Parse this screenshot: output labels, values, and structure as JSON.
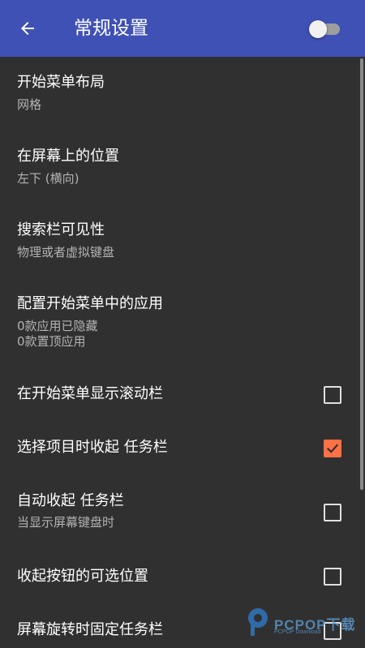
{
  "toolbar": {
    "title": "常规设置",
    "back_icon": "arrow-back-icon",
    "toggle_on": false,
    "background_color": "#3f51b5"
  },
  "settings": [
    {
      "title": "开始菜单布局",
      "subtitle": "网格"
    },
    {
      "title": "在屏幕上的位置",
      "subtitle": "左下 (横向)"
    },
    {
      "title": "搜索栏可见性",
      "subtitle": "物理或者虚拟键盘"
    },
    {
      "title": "配置开始菜单中的应用",
      "subtitle": "0款应用已隐藏",
      "subtitle2": "0款置顶应用"
    },
    {
      "title": "在开始菜单显示滚动栏",
      "checked": false
    },
    {
      "title": "选择项目时收起 任务栏",
      "checked": true
    },
    {
      "title": "自动收起 任务栏",
      "subtitle": "当显示屏幕键盘时",
      "checked": false
    },
    {
      "title": "收起按钮的可选位置",
      "checked": false
    },
    {
      "title": "屏幕旋转时固定任务栏",
      "checked": false
    }
  ],
  "colors": {
    "background": "#303030",
    "checkbox_checked": "#ff7043",
    "primary_text": "#ffffff",
    "secondary_text": "#b3b3b3"
  },
  "watermark": {
    "text": "PCPOP下载",
    "subtext": "PCPOP Download",
    "logo_icon": "pcpop-logo"
  }
}
